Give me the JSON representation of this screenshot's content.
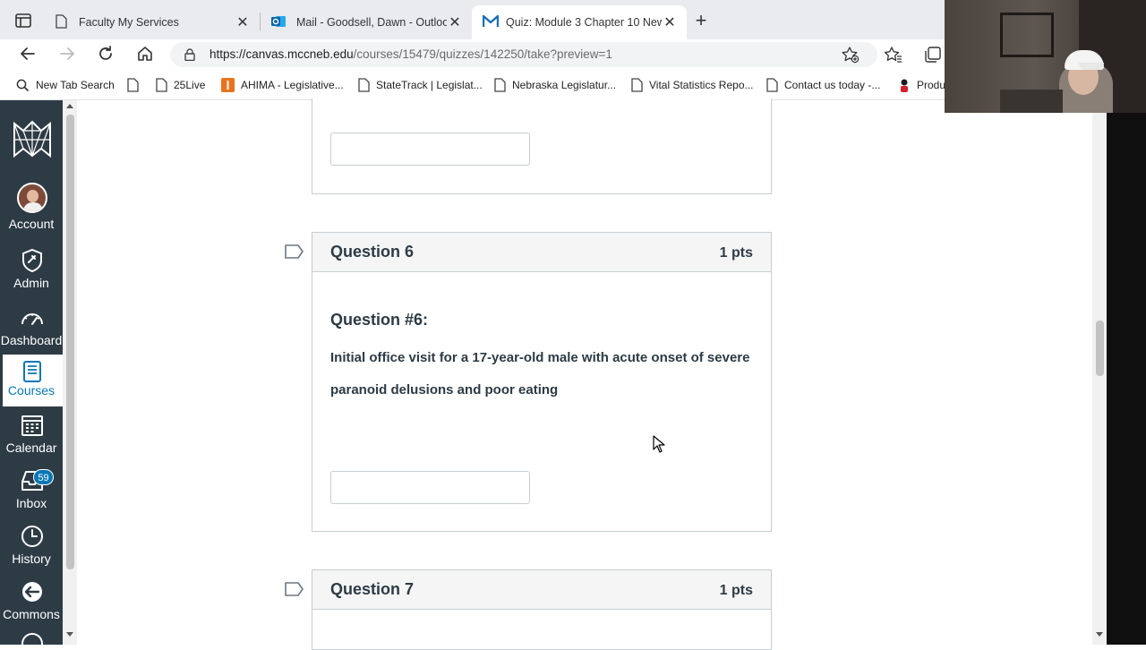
{
  "browser": {
    "tabs": [
      {
        "title": "Faculty My Services",
        "icon": "page-icon"
      },
      {
        "title": "Mail - Goodsell, Dawn - Outlook",
        "icon": "outlook-icon"
      },
      {
        "title": "Quiz: Module 3 Chapter 10 New",
        "icon": "canvas-icon"
      }
    ],
    "url_main": "https://canvas.mccneb.edu",
    "url_path": "/courses/15479/quizzes/142250/take?preview=1",
    "bookmarks": [
      "New Tab Search",
      "",
      "25Live",
      "AHIMA - Legislative...",
      "StateTrack | Legislat...",
      "Nebraska Legislatur...",
      "Vital Statistics Repo...",
      "Contact us today -...",
      "Produ"
    ]
  },
  "nav": {
    "account": "Account",
    "admin": "Admin",
    "dashboard": "Dashboard",
    "courses": "Courses",
    "calendar": "Calendar",
    "inbox": "Inbox",
    "inbox_count": "59",
    "history": "History",
    "commons": "Commons"
  },
  "questions": {
    "q6": {
      "name": "Question 6",
      "points": "1 pts",
      "title": "Question #6:",
      "text": "Initial office visit for a 17-year-old male with acute onset of severe paranoid delusions and poor eating"
    },
    "q7": {
      "name": "Question 7",
      "points": "1 pts"
    }
  },
  "colors": {
    "nav_bg": "#2d3b45",
    "accent": "#0a77b5",
    "text": "#2d3b45"
  }
}
